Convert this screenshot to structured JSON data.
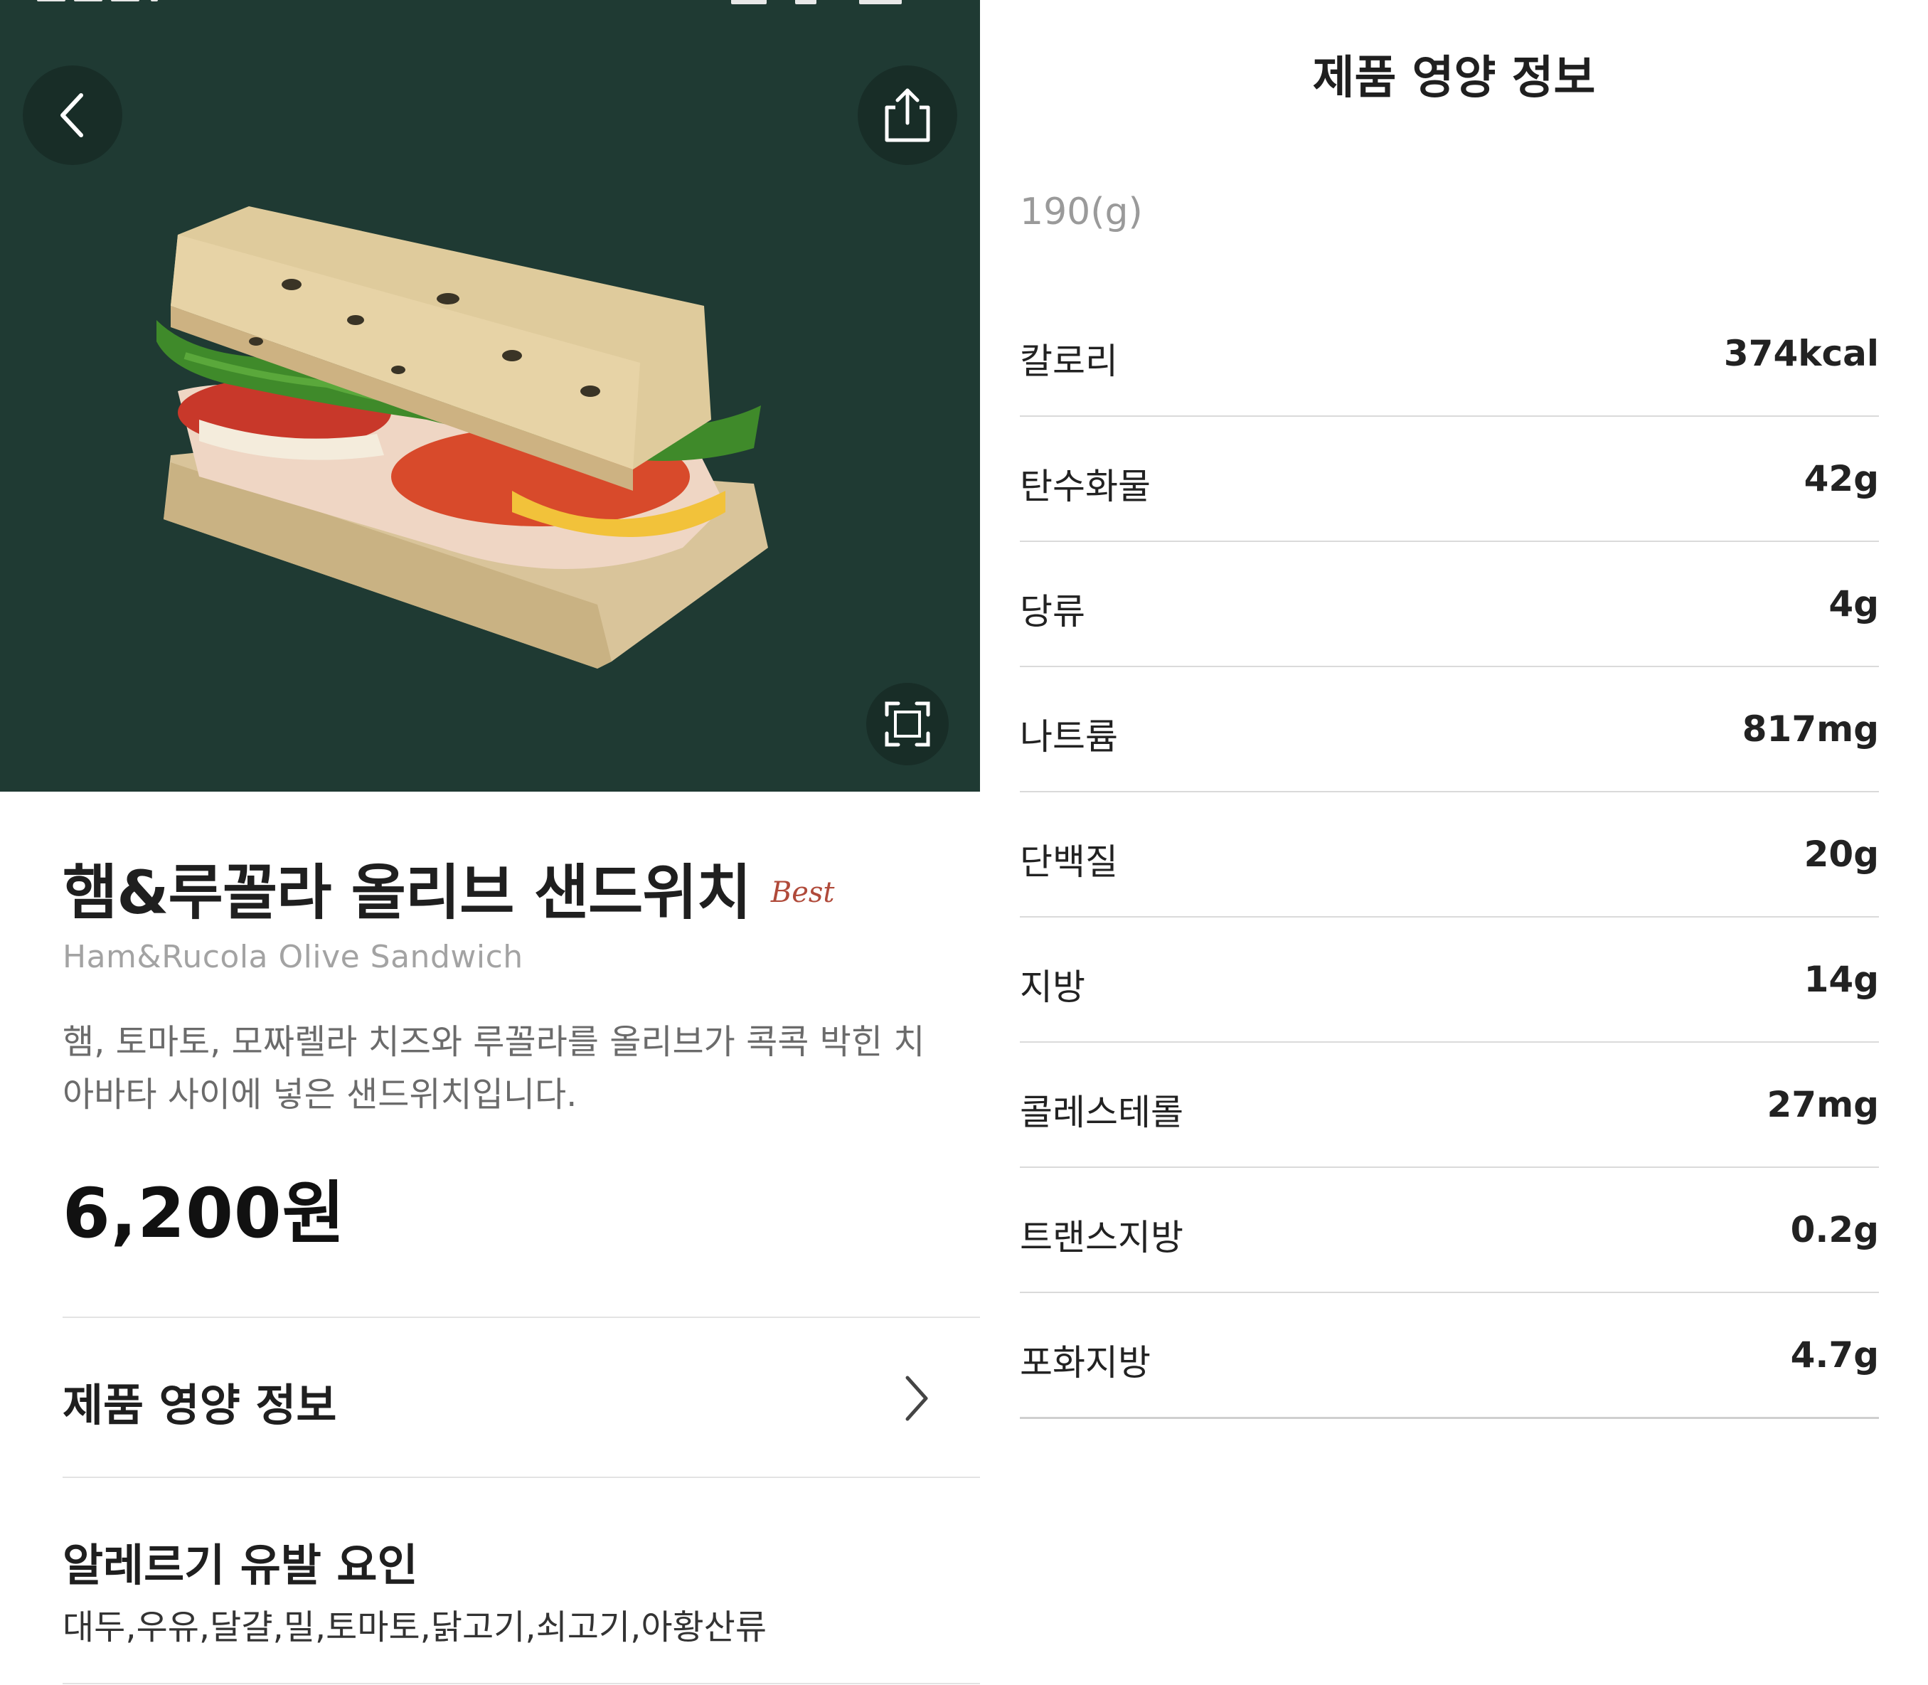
{
  "product": {
    "title": "햄&루꼴라 올리브 샌드위치",
    "badge": "Best",
    "subtitle": "Ham&Rucola Olive Sandwich",
    "description": "햄, 토마토, 모짜렐라 치즈와 루꼴라를 올리브가 콕콕 박힌 치아바타 사이에 넣은 샌드위치입니다.",
    "price": "6,200원"
  },
  "sections": {
    "nutrition_link_label": "제품 영양 정보",
    "allergy_title": "알레르기 유발 요인",
    "allergy_list": "대두,우유,달걀,밀,토마토,닭고기,쇠고기,아황산류"
  },
  "nutrition_panel": {
    "title": "제품 영양 정보",
    "serving": "190(g)",
    "rows": [
      {
        "name": "칼로리",
        "value": "374kcal"
      },
      {
        "name": "탄수화물",
        "value": "42g"
      },
      {
        "name": "당류",
        "value": "4g"
      },
      {
        "name": "나트륨",
        "value": "817mg"
      },
      {
        "name": "단백질",
        "value": "20g"
      },
      {
        "name": "지방",
        "value": "14g"
      },
      {
        "name": "콜레스테롤",
        "value": "27mg"
      },
      {
        "name": "트랜스지방",
        "value": "0.2g"
      },
      {
        "name": "포화지방",
        "value": "4.7g"
      }
    ]
  },
  "icons": {
    "back": "chevron-left-icon",
    "share": "share-icon",
    "expand": "expand-icon",
    "chevron": "chevron-right-icon"
  },
  "colors": {
    "hero_background": "#1f3a33",
    "badge": "#b04a3a"
  }
}
